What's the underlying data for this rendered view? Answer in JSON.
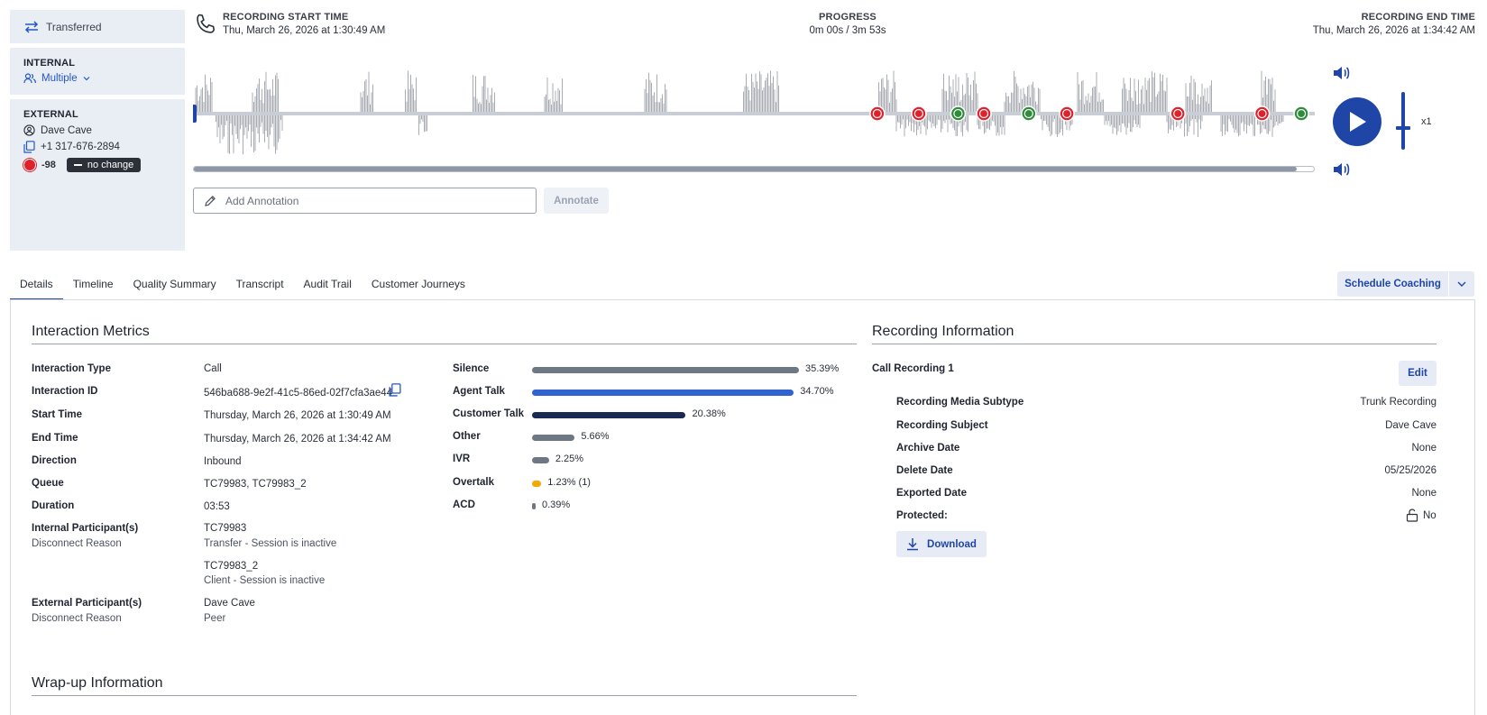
{
  "left_panel": {
    "transferred_label": "Transferred",
    "internal": {
      "heading": "INTERNAL",
      "participants_label": "Multiple"
    },
    "external": {
      "heading": "EXTERNAL",
      "name": "Dave Cave",
      "phone": "+1 317-676-2894",
      "sentiment_score": "-98",
      "sentiment_trend": "no change"
    }
  },
  "header": {
    "start_label": "RECORDING START TIME",
    "start_value": "Thu, March 26, 2026 at 1:30:49 AM",
    "progress_label": "PROGRESS",
    "progress_value": "0m 00s / 3m 53s",
    "end_label": "RECORDING END TIME",
    "end_value": "Thu, March 26, 2026 at 1:34:42 AM"
  },
  "player": {
    "speed": "x1",
    "playback_position": 0,
    "buffered_fraction": 0.985,
    "sentiment_markers": [
      {
        "pos": 0.61,
        "type": "negative"
      },
      {
        "pos": 0.647,
        "type": "negative"
      },
      {
        "pos": 0.682,
        "type": "neutral"
      },
      {
        "pos": 0.705,
        "type": "negative"
      },
      {
        "pos": 0.745,
        "type": "neutral"
      },
      {
        "pos": 0.779,
        "type": "negative"
      },
      {
        "pos": 0.878,
        "type": "negative"
      },
      {
        "pos": 0.953,
        "type": "negative"
      },
      {
        "pos": 0.988,
        "type": "positive"
      }
    ]
  },
  "annotation": {
    "placeholder": "Add Annotation",
    "button": "Annotate"
  },
  "tabs": [
    "Details",
    "Timeline",
    "Quality Summary",
    "Transcript",
    "Audit Trail",
    "Customer Journeys"
  ],
  "actions": {
    "schedule_coaching": "Schedule Coaching"
  },
  "interaction_metrics": {
    "title": "Interaction Metrics",
    "fields": [
      {
        "label": "Interaction Type",
        "value": "Call"
      },
      {
        "label": "Interaction ID",
        "value": "546ba688-9e2f-41c5-86ed-02f7cfa3ae44"
      },
      {
        "label": "Start Time",
        "value": "Thursday, March 26, 2026 at 1:30:49 AM"
      },
      {
        "label": "End Time",
        "value": "Thursday, March 26, 2026 at 1:34:42 AM"
      },
      {
        "label": "Direction",
        "value": "Inbound"
      },
      {
        "label": "Queue",
        "value": "TC79983, TC79983_2"
      },
      {
        "label": "Duration",
        "value": "03:53"
      }
    ],
    "internal_participants": {
      "label": "Internal Participant(s)",
      "sub_label": "Disconnect Reason",
      "items": [
        {
          "name": "TC79983",
          "reason": "Transfer - Session is inactive"
        },
        {
          "name": "TC79983_2",
          "reason": "Client - Session is inactive"
        }
      ]
    },
    "external_participants": {
      "label": "External Participant(s)",
      "sub_label": "Disconnect Reason",
      "name": "Dave Cave",
      "reason": "Peer"
    },
    "breakdown": [
      {
        "label": "Silence",
        "percent": 35.39,
        "text": "35.39%",
        "color": "#6e7885"
      },
      {
        "label": "Agent Talk",
        "percent": 34.7,
        "text": "34.70%",
        "color": "#2f63d0"
      },
      {
        "label": "Customer Talk",
        "percent": 20.38,
        "text": "20.38%",
        "color": "#1a2a52"
      },
      {
        "label": "Other",
        "percent": 5.66,
        "text": "5.66%",
        "color": "#6e7885"
      },
      {
        "label": "IVR",
        "percent": 2.25,
        "text": "2.25%",
        "color": "#6e7885"
      },
      {
        "label": "Overtalk",
        "percent": 1.23,
        "text": "1.23% (1)",
        "color": "#f2a900"
      },
      {
        "label": "ACD",
        "percent": 0.39,
        "text": "0.39%",
        "color": "#6e7885"
      }
    ]
  },
  "wrapup": {
    "title": "Wrap-up Information"
  },
  "recording_info": {
    "title": "Recording Information",
    "recording_name": "Call Recording 1",
    "edit_label": "Edit",
    "fields": [
      {
        "label": "Recording Media Subtype",
        "value": "Trunk Recording"
      },
      {
        "label": "Recording Subject",
        "value": "Dave Cave"
      },
      {
        "label": "Archive Date",
        "value": "None"
      },
      {
        "label": "Delete Date",
        "value": "05/25/2026"
      },
      {
        "label": "Exported Date",
        "value": "None"
      },
      {
        "label": "Protected:",
        "value": "No"
      }
    ],
    "download_label": "Download"
  }
}
